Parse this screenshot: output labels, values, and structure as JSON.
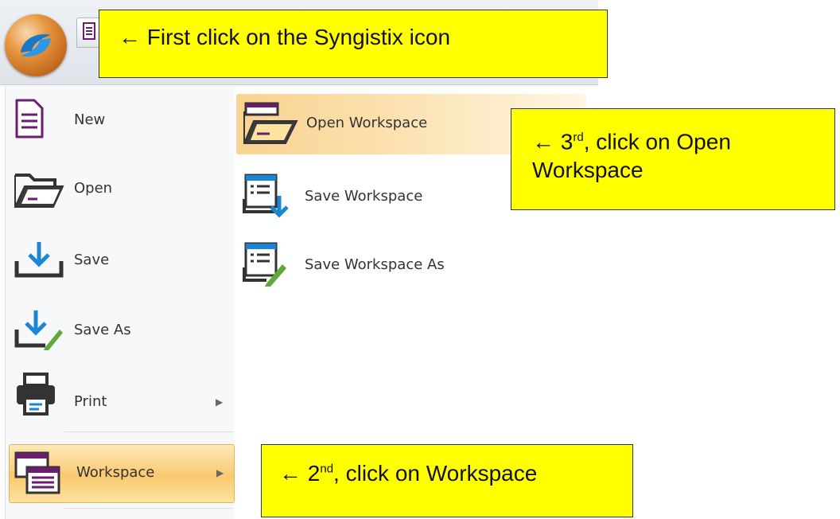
{
  "window": {
    "orb_label": "Syngistix",
    "doc_tab_icon": "document-icon"
  },
  "menu": {
    "items": [
      {
        "label": "New",
        "icon": "new-document-icon"
      },
      {
        "label": "Open",
        "icon": "open-folder-icon"
      },
      {
        "label": "Save",
        "icon": "save-download-icon"
      },
      {
        "label": "Save As",
        "icon": "save-as-icon"
      },
      {
        "label": "Print",
        "icon": "printer-icon",
        "has_submenu": true
      },
      {
        "label": "Workspace",
        "icon": "workspace-icon",
        "has_submenu": true,
        "selected": true
      }
    ]
  },
  "submenu": {
    "items": [
      {
        "label": "Open Workspace",
        "icon": "open-workspace-icon",
        "highlighted": true
      },
      {
        "label": "Save Workspace",
        "icon": "save-workspace-icon"
      },
      {
        "label": "Save Workspace As",
        "icon": "save-workspace-as-icon"
      }
    ]
  },
  "callouts": {
    "first": {
      "arrow": "←",
      "text": "First click on the Syngistix icon"
    },
    "second": {
      "arrow": "←",
      "num": "2",
      "sup": "nd",
      "text": ", click on Workspace"
    },
    "third": {
      "arrow": "←",
      "num": "3",
      "sup": "rd",
      "line1": ", click on Open",
      "line2": "Workspace"
    }
  },
  "colors": {
    "highlight": "#f9c970",
    "callout": "#ffff00",
    "accent_purple": "#6b1e6e",
    "accent_blue": "#1b86d6"
  }
}
